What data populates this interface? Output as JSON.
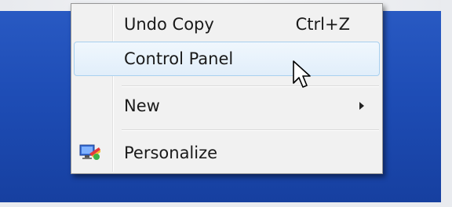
{
  "context_menu": {
    "items": [
      {
        "label": "Undo Copy",
        "shortcut": "Ctrl+Z"
      },
      {
        "label": "Control Panel"
      },
      {
        "label": "New"
      },
      {
        "label": "Personalize",
        "icon": "personalize-icon"
      }
    ]
  },
  "colors": {
    "desktop": "#1e4db6",
    "menu_bg": "#f1f1f1",
    "highlight_border": "#a8d0ef"
  }
}
